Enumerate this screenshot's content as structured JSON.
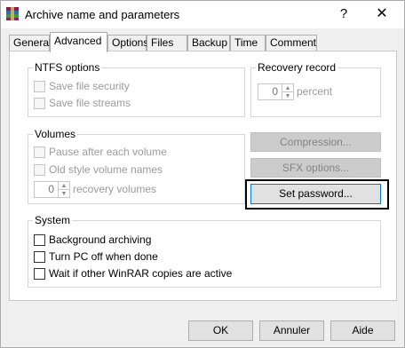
{
  "window": {
    "title": "Archive name and parameters",
    "help_glyph": "?",
    "close_glyph": "✕",
    "icon": "winrar-books-icon"
  },
  "tabs": [
    {
      "label": "General",
      "active": false
    },
    {
      "label": "Advanced",
      "active": true
    },
    {
      "label": "Options",
      "active": false
    },
    {
      "label": "Files",
      "active": false
    },
    {
      "label": "Backup",
      "active": false
    },
    {
      "label": "Time",
      "active": false
    },
    {
      "label": "Comment",
      "active": false
    }
  ],
  "ntfs": {
    "title": "NTFS options",
    "save_security": {
      "label": "Save file security",
      "checked": false,
      "enabled": false
    },
    "save_streams": {
      "label": "Save file streams",
      "checked": false,
      "enabled": false
    }
  },
  "recovery_record": {
    "title": "Recovery record",
    "value": "0",
    "unit": "percent",
    "enabled": false
  },
  "volumes": {
    "title": "Volumes",
    "pause": {
      "label": "Pause after each volume",
      "checked": false,
      "enabled": false
    },
    "old_style": {
      "label": "Old style volume names",
      "checked": false,
      "enabled": false
    },
    "recovery_value": "0",
    "recovery_label": "recovery volumes"
  },
  "buttons": {
    "compression": {
      "label": "Compression...",
      "enabled": false
    },
    "sfx": {
      "label": "SFX options...",
      "enabled": false
    },
    "set_password": {
      "label": "Set password...",
      "enabled": true,
      "highlighted": true
    }
  },
  "system": {
    "title": "System",
    "background": {
      "label": "Background archiving",
      "checked": false
    },
    "turn_off": {
      "label": "Turn PC off when done",
      "checked": false
    },
    "wait": {
      "label": "Wait if other WinRAR copies are active",
      "checked": false
    }
  },
  "footer": {
    "ok": "OK",
    "cancel": "Annuler",
    "help": "Aide"
  },
  "colors": {
    "dialog_bg": "#f0f0f0",
    "panel_bg": "#ffffff",
    "disabled_text": "#9b9b9b",
    "highlight_frame": "#000000"
  }
}
